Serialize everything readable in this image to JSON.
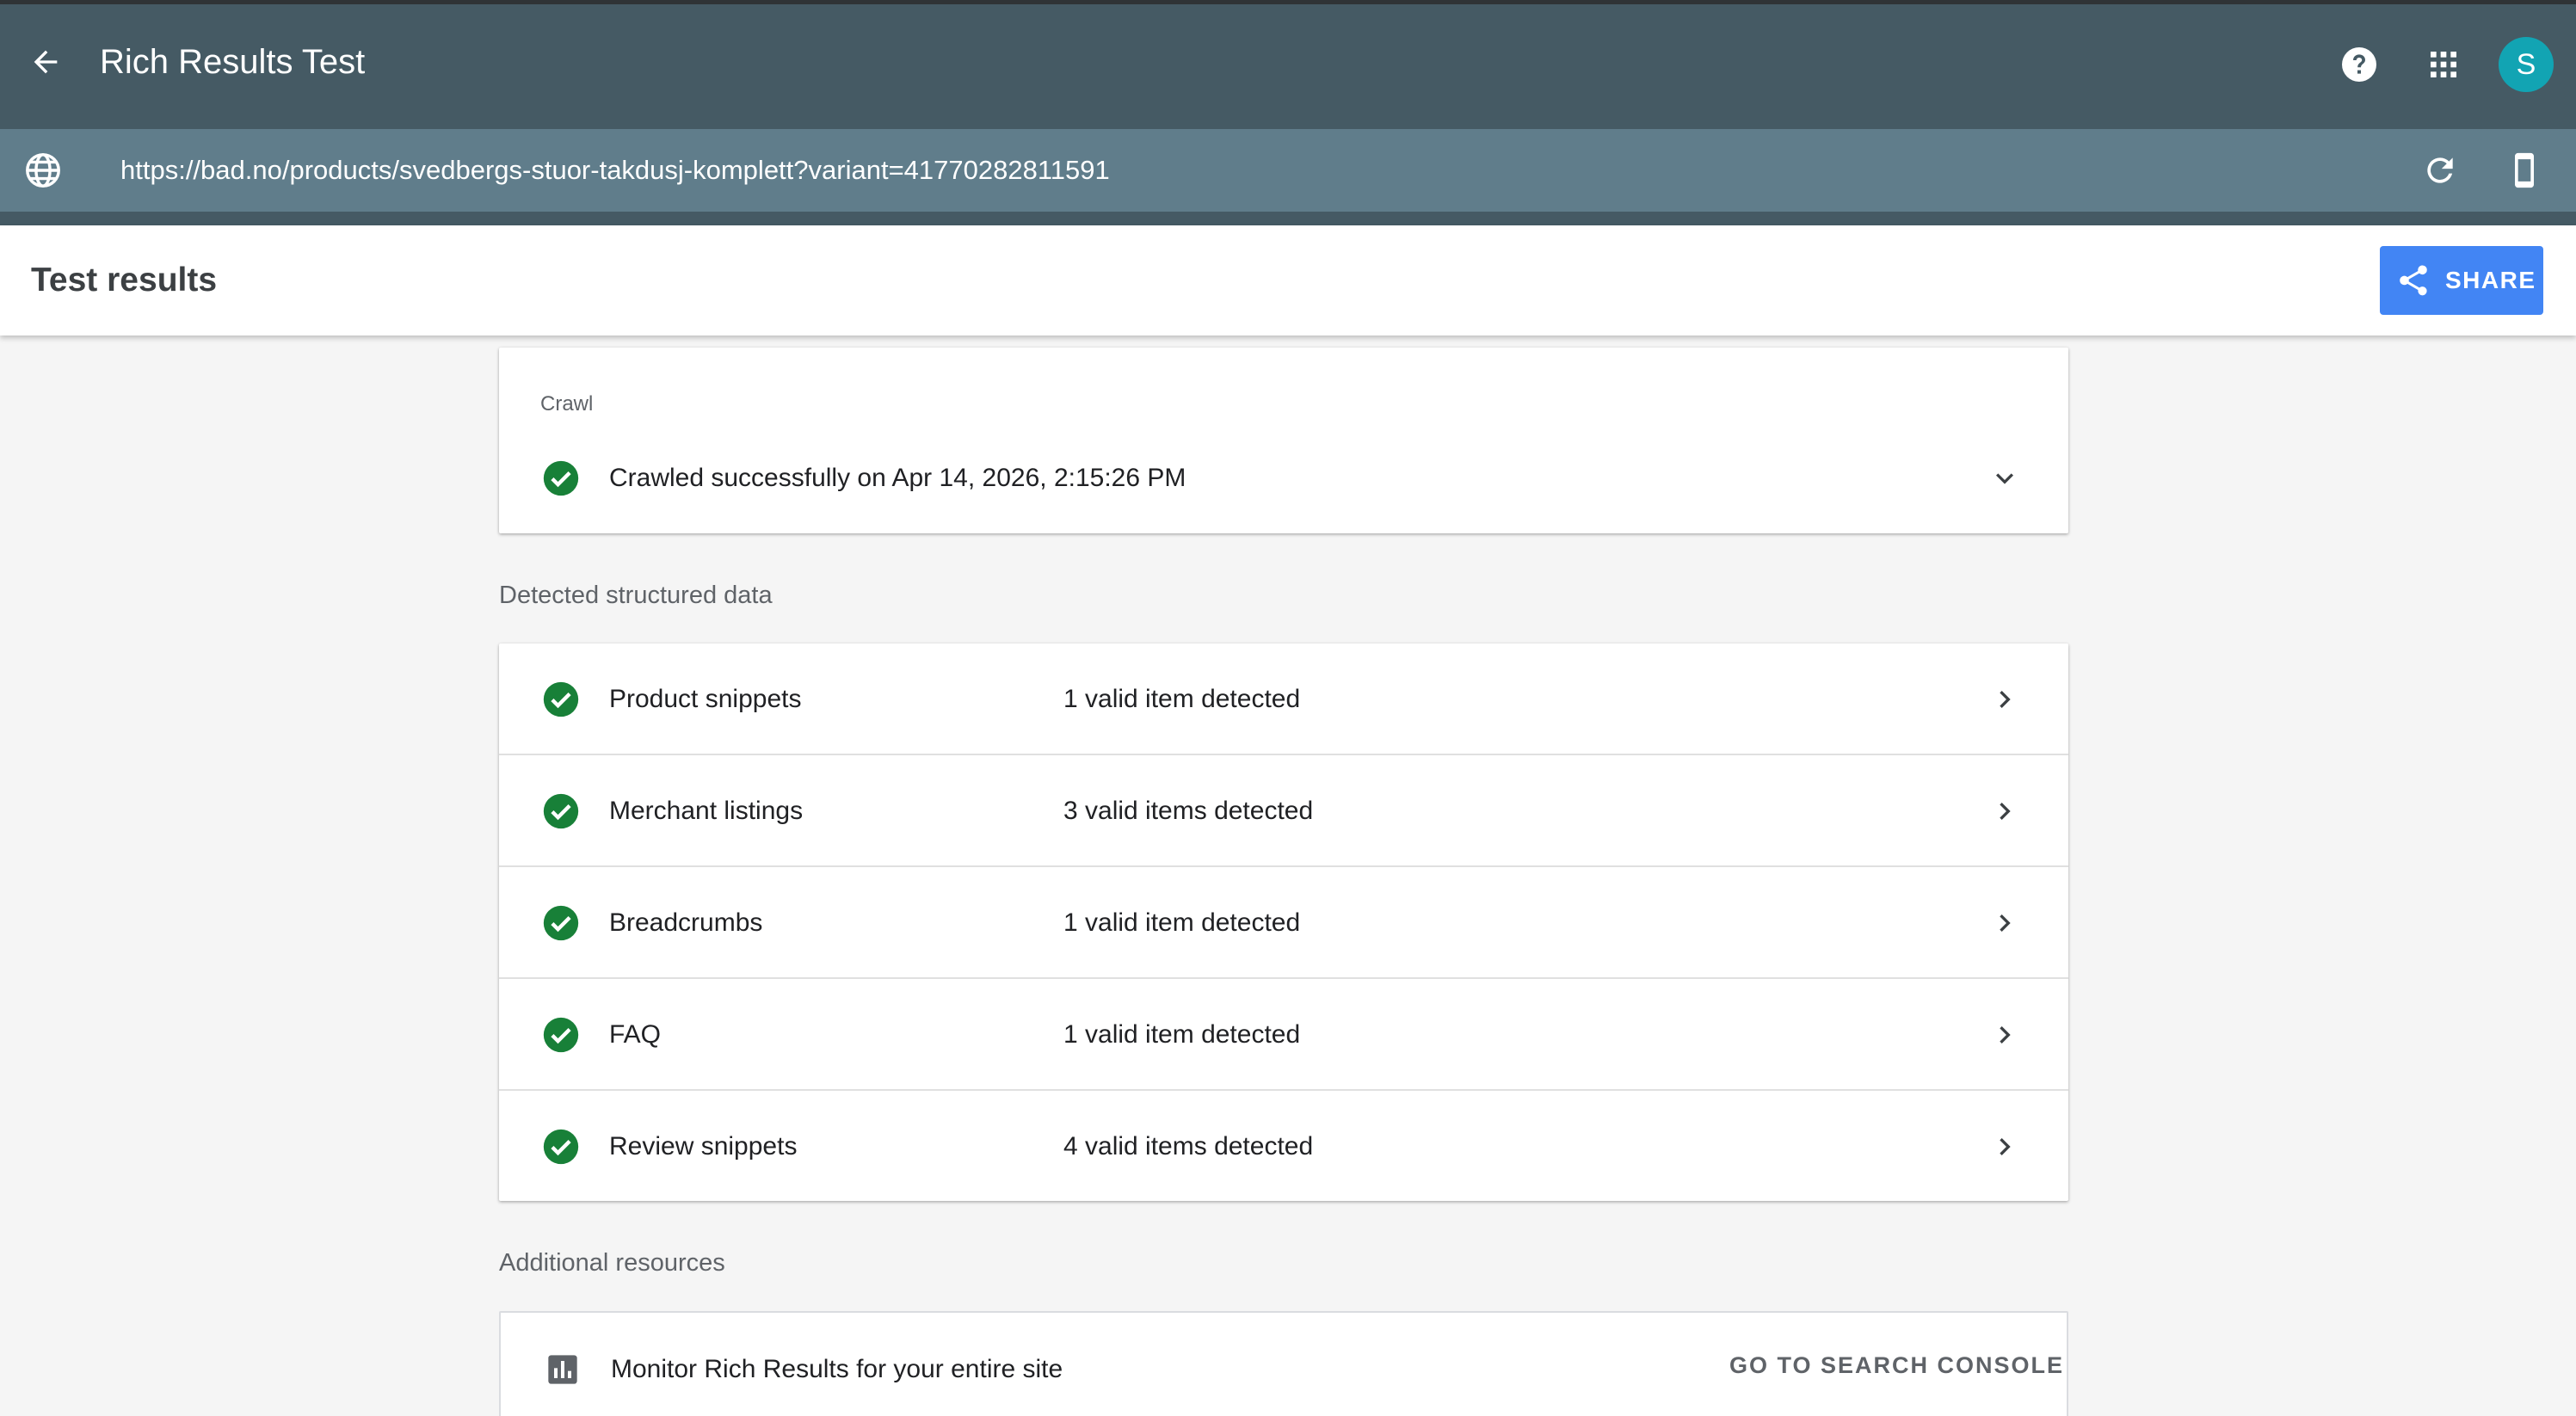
{
  "app": {
    "title": "Rich Results Test",
    "avatar_letter": "S",
    "colors": {
      "topbar": "#455a64",
      "urlbar": "#607d8b",
      "avatar": "#12a4b3",
      "share_button": "#4285f4",
      "success_check": "#188038"
    }
  },
  "url_bar": {
    "url": "https://bad.no/products/svedbergs-stuor-takdusj-komplett?variant=41770282811591"
  },
  "results": {
    "title": "Test results",
    "share_label": "SHARE"
  },
  "crawl": {
    "label": "Crawl",
    "status": "Crawled successfully on Apr 14, 2026, 2:15:26 PM"
  },
  "structured_data": {
    "heading": "Detected structured data",
    "items": [
      {
        "name": "Product snippets",
        "status": "1 valid item detected"
      },
      {
        "name": "Merchant listings",
        "status": "3 valid items detected"
      },
      {
        "name": "Breadcrumbs",
        "status": "1 valid item detected"
      },
      {
        "name": "FAQ",
        "status": "1 valid item detected"
      },
      {
        "name": "Review snippets",
        "status": "4 valid items detected"
      }
    ]
  },
  "additional_resources": {
    "heading": "Additional resources",
    "monitor_text": "Monitor Rich Results for your entire site",
    "link_label": "GO TO SEARCH CONSOLE"
  },
  "icons": {
    "back": "arrow-back-icon",
    "help": "help-icon",
    "apps": "apps-grid-icon",
    "globe": "globe-icon",
    "reload": "reload-icon",
    "device": "smartphone-icon",
    "share": "share-icon",
    "check": "check-circle-icon",
    "expand": "chevron-down-icon",
    "open": "chevron-right-icon",
    "chart": "bar-chart-icon"
  }
}
